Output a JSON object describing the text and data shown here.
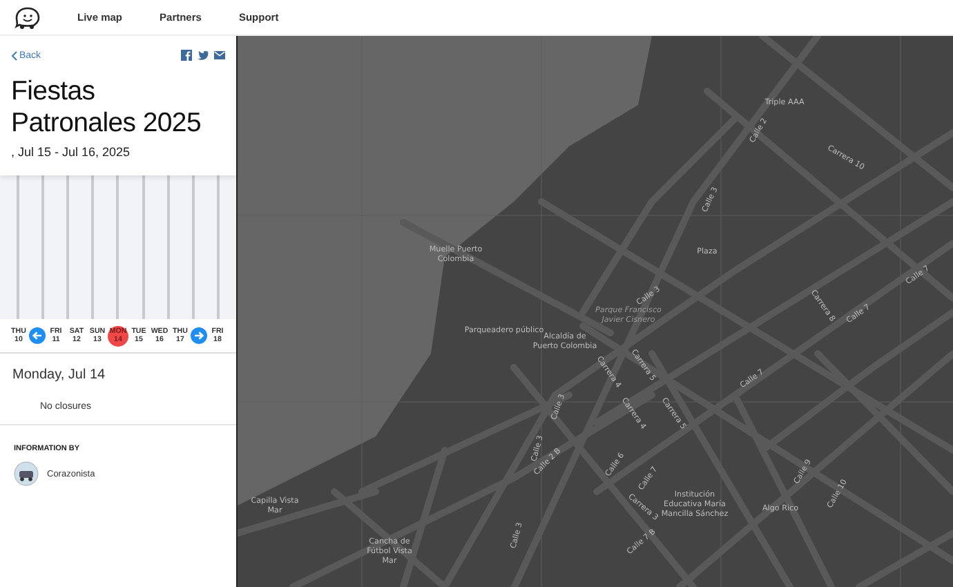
{
  "nav": {
    "links": [
      {
        "label": "Live map"
      },
      {
        "label": "Partners"
      },
      {
        "label": "Support"
      }
    ]
  },
  "event": {
    "back": "Back",
    "title": "Fiestas Patronales 2025",
    "dates": ", Jul 15 - Jul 16, 2025"
  },
  "timeline": {
    "days": [
      {
        "weekday": "THU",
        "date": "10",
        "selected": false
      },
      {
        "weekday": "FRI",
        "date": "11",
        "selected": false
      },
      {
        "weekday": "SAT",
        "date": "12",
        "selected": false
      },
      {
        "weekday": "SUN",
        "date": "13",
        "selected": false
      },
      {
        "weekday": "MON",
        "date": "14",
        "selected": true
      },
      {
        "weekday": "TUE",
        "date": "15",
        "selected": false
      },
      {
        "weekday": "WED",
        "date": "16",
        "selected": false
      },
      {
        "weekday": "THU",
        "date": "17",
        "selected": false
      },
      {
        "weekday": "FRI",
        "date": "18",
        "selected": false
      }
    ]
  },
  "day_detail": {
    "heading": "Monday, Jul 14",
    "status": "No closures"
  },
  "information": {
    "heading": "INFORMATION BY",
    "author": "Corazonista"
  },
  "map": {
    "labels": [
      {
        "text": "Triple AAA",
        "kind": "place"
      },
      {
        "text": "Calle 2",
        "kind": "street"
      },
      {
        "text": "Carrera 10",
        "kind": "street"
      },
      {
        "text": "Calle 3",
        "kind": "street"
      },
      {
        "text": "Muelle Puerto Colombia",
        "kind": "place"
      },
      {
        "text": "Plaza",
        "kind": "place"
      },
      {
        "text": "Calle 3",
        "kind": "street"
      },
      {
        "text": "Parque Francisco Javier Cisnero",
        "kind": "park"
      },
      {
        "text": "Parqueadero público",
        "kind": "place"
      },
      {
        "text": "Alcaldía de Puerto Colombia",
        "kind": "place"
      },
      {
        "text": "Carrera 8",
        "kind": "street"
      },
      {
        "text": "Calle 7",
        "kind": "street"
      },
      {
        "text": "Calle 7",
        "kind": "street"
      },
      {
        "text": "Carrera 4",
        "kind": "street"
      },
      {
        "text": "Carrera 5",
        "kind": "street"
      },
      {
        "text": "Calle 7",
        "kind": "street"
      },
      {
        "text": "Carrera 4",
        "kind": "street"
      },
      {
        "text": "Carrera 5",
        "kind": "street"
      },
      {
        "text": "Calle 3",
        "kind": "street"
      },
      {
        "text": "Calle 3",
        "kind": "street"
      },
      {
        "text": "Calle 2 B",
        "kind": "street"
      },
      {
        "text": "Calle 6",
        "kind": "street"
      },
      {
        "text": "Calle 7",
        "kind": "street"
      },
      {
        "text": "Calle 9",
        "kind": "street"
      },
      {
        "text": "Institución Educativa María Mancilla Sánchez",
        "kind": "place"
      },
      {
        "text": "Carrera 3",
        "kind": "street"
      },
      {
        "text": "Calle 10",
        "kind": "street"
      },
      {
        "text": "Algo Rico",
        "kind": "place"
      },
      {
        "text": "Capilla Vista Mar",
        "kind": "place"
      },
      {
        "text": "Calle 7 B",
        "kind": "street"
      },
      {
        "text": "Calle 3",
        "kind": "street"
      },
      {
        "text": "Cancha de Fútbol Vista Mar",
        "kind": "place"
      }
    ]
  }
}
